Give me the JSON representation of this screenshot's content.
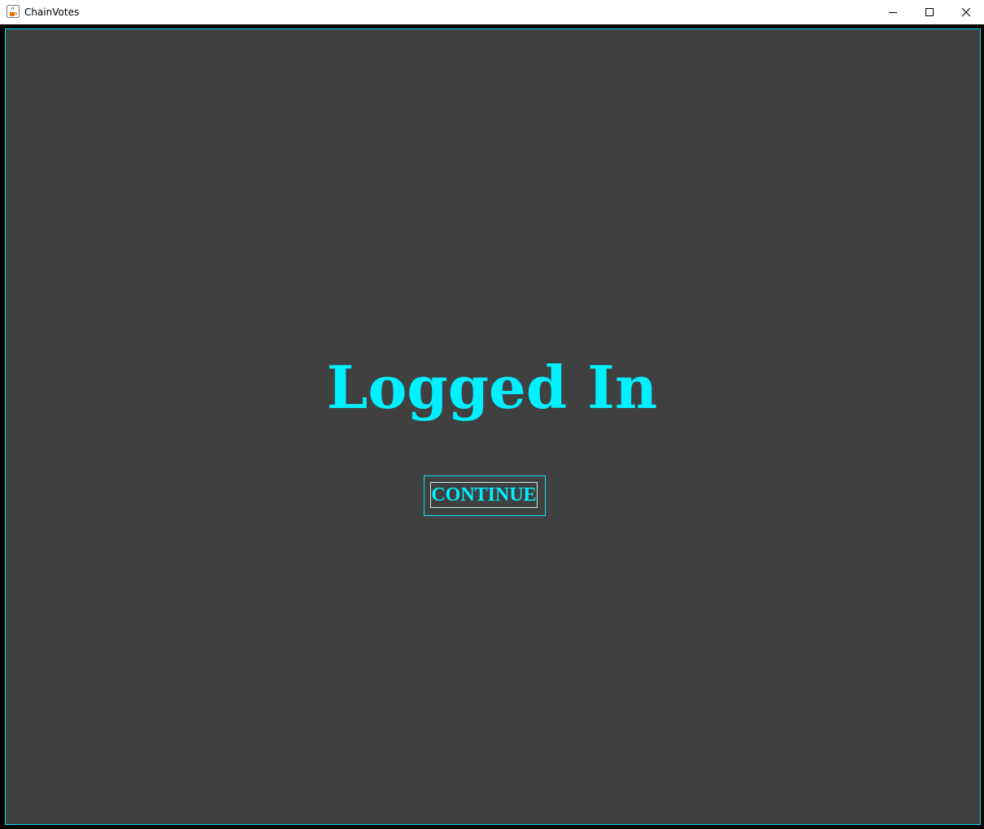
{
  "window": {
    "title": "ChainVotes",
    "app_icon": "java-coffee-icon",
    "controls": {
      "minimize_icon": "minimize-icon",
      "maximize_icon": "maximize-icon",
      "close_icon": "close-icon"
    }
  },
  "main": {
    "heading": "Logged In",
    "continue_label": "CONTINUE"
  },
  "colors": {
    "accent": "#00f0ff",
    "background": "#404040",
    "frame": "#000000"
  }
}
